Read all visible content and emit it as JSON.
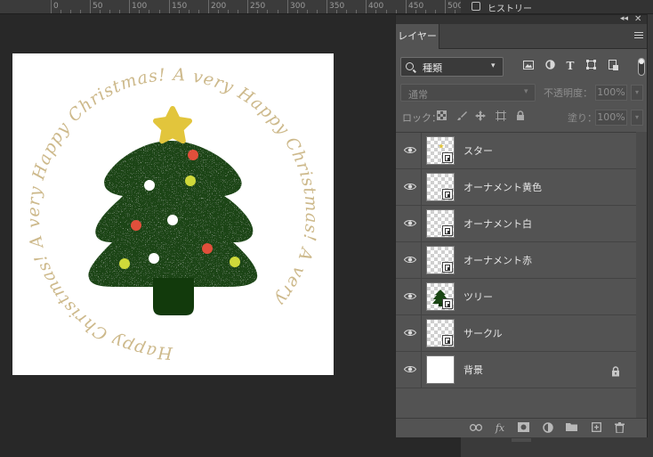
{
  "ruler": {
    "ticks": [
      "0",
      "50",
      "100",
      "150",
      "200",
      "250",
      "300",
      "350",
      "400",
      "450",
      "500"
    ]
  },
  "history_panel": {
    "label": "ヒストリー",
    "icon": "history-icon"
  },
  "layers_panel": {
    "tab_label": "レイヤー",
    "filter": {
      "value": "種類",
      "icons": [
        "image-filter-icon",
        "adjustment-filter-icon",
        "type-filter-icon",
        "shape-filter-icon",
        "smart-object-filter-icon"
      ]
    },
    "blend_mode": "通常",
    "opacity": {
      "label": "不透明度：",
      "value": "100%"
    },
    "lock": {
      "label": "ロック：",
      "icons": [
        "lock-transparency-icon",
        "lock-image-icon",
        "lock-position-icon",
        "lock-artboard-icon",
        "lock-all-icon"
      ]
    },
    "fill": {
      "label": "塗り：",
      "value": "100%"
    },
    "layers": [
      {
        "name": "スター",
        "visible": true,
        "thumb": "star",
        "smart_object": true,
        "locked": false
      },
      {
        "name": "オーナメント黄色",
        "visible": true,
        "thumb": "transparent",
        "smart_object": true,
        "locked": false
      },
      {
        "name": "オーナメント白",
        "visible": true,
        "thumb": "transparent",
        "smart_object": true,
        "locked": false
      },
      {
        "name": "オーナメント赤",
        "visible": true,
        "thumb": "transparent",
        "smart_object": true,
        "locked": false
      },
      {
        "name": "ツリー",
        "visible": true,
        "thumb": "tree",
        "smart_object": true,
        "locked": false
      },
      {
        "name": "サークル",
        "visible": true,
        "thumb": "transparent",
        "smart_object": true,
        "locked": false
      },
      {
        "name": "背景",
        "visible": true,
        "thumb": "white",
        "smart_object": false,
        "locked": true
      }
    ],
    "footer_icons": [
      "link-layers-icon",
      "layer-style-fx-icon",
      "add-mask-icon",
      "adjustment-layer-icon",
      "new-group-icon",
      "new-layer-icon",
      "delete-layer-icon"
    ]
  },
  "document": {
    "circle_text": "Happy Christmas! A very Happy Christmas! A very Happy Christmas! A very ",
    "colors": {
      "tree": "#1a4514",
      "trunk": "#123a0c",
      "star": "#e2c53c",
      "ornament_red": "#e04f3b",
      "ornament_yellow": "#cfd93a",
      "ornament_white": "#ffffff",
      "text": "#cdb98b"
    }
  }
}
